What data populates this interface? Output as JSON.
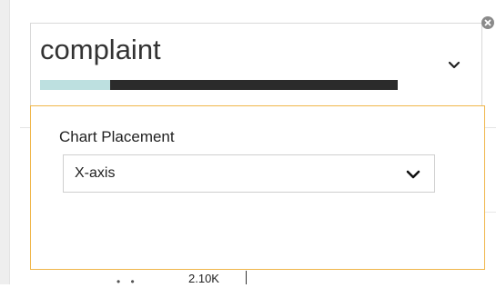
{
  "card": {
    "title": "complaint",
    "progress_fraction": 0.195,
    "colors": {
      "bar_fill": "#bde0e0",
      "bar_track": "#2b2b2b"
    },
    "expand_icon": "chevron-down-icon",
    "remove_icon": "close-icon"
  },
  "panel": {
    "label": "Chart Placement",
    "select": {
      "value": "X-axis",
      "icon": "chevron-down-icon"
    },
    "accent_color": "#f0b64a"
  },
  "background_chart": {
    "tick_label": "2.10K"
  }
}
